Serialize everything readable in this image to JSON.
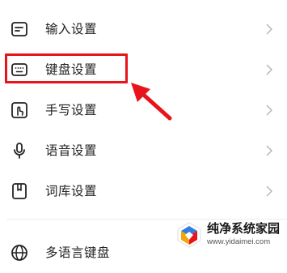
{
  "menu": {
    "items": [
      {
        "label": "输入设置",
        "icon": "input-settings-icon"
      },
      {
        "label": "键盘设置",
        "icon": "keyboard-icon"
      },
      {
        "label": "手写设置",
        "icon": "handwriting-icon"
      },
      {
        "label": "语音设置",
        "icon": "microphone-icon"
      },
      {
        "label": "词库设置",
        "icon": "dictionary-icon"
      },
      {
        "label": "多语言键盘",
        "icon": "globe-icon"
      }
    ],
    "chevron_icon": "chevron-right-icon"
  },
  "annotation": {
    "highlight_color": "#e8141c",
    "highlighted_item": "键盘设置"
  },
  "watermark": {
    "title": "纯净系统家园",
    "url": "www.yidaimei.com"
  }
}
